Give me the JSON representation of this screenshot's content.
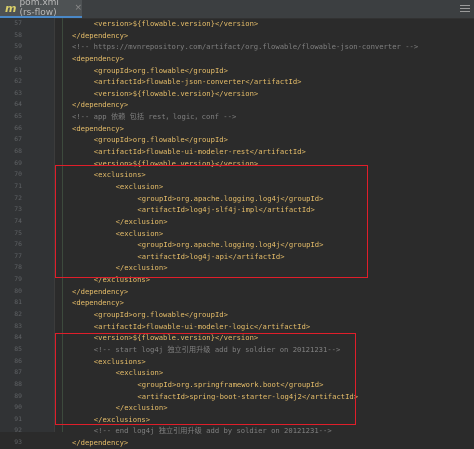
{
  "tab": {
    "title": "pom.xml (rs-flow)",
    "close": "×"
  },
  "lines": [
    {
      "n": "57",
      "i": 4,
      "t": "tag",
      "s": "<version>${flowable.version}</version>"
    },
    {
      "n": "58",
      "i": 2,
      "t": "tag",
      "s": "</dependency>"
    },
    {
      "n": "59",
      "i": 2,
      "t": "cmt",
      "s": "<!-- https://mvnrepository.com/artifact/org.flowable/flowable-json-converter -->"
    },
    {
      "n": "60",
      "i": 2,
      "t": "tag",
      "s": "<dependency>"
    },
    {
      "n": "61",
      "i": 4,
      "t": "tag",
      "s": "<groupId>org.flowable</groupId>"
    },
    {
      "n": "62",
      "i": 4,
      "t": "tag",
      "s": "<artifactId>flowable-json-converter</artifactId>"
    },
    {
      "n": "63",
      "i": 4,
      "t": "tag",
      "s": "<version>${flowable.version}</version>"
    },
    {
      "n": "64",
      "i": 2,
      "t": "tag",
      "s": "</dependency>"
    },
    {
      "n": "65",
      "i": 2,
      "t": "cmt",
      "s": "<!-- app 依赖 包括 rest，logic，conf -->"
    },
    {
      "n": "66",
      "i": 2,
      "t": "tag",
      "s": "<dependency>"
    },
    {
      "n": "67",
      "i": 4,
      "t": "tag",
      "s": "<groupId>org.flowable</groupId>"
    },
    {
      "n": "68",
      "i": 4,
      "t": "tag",
      "s": "<artifactId>flowable-ui-modeler-rest</artifactId>"
    },
    {
      "n": "69",
      "i": 4,
      "t": "tag",
      "s": "<version>${flowable.version}</version>"
    },
    {
      "n": "70",
      "i": 4,
      "t": "tag",
      "s": "<exclusions>"
    },
    {
      "n": "71",
      "i": 6,
      "t": "tag",
      "s": "<exclusion>"
    },
    {
      "n": "72",
      "i": 8,
      "t": "tag",
      "s": "<groupId>org.apache.logging.log4j</groupId>"
    },
    {
      "n": "73",
      "i": 8,
      "t": "tag",
      "s": "<artifactId>log4j-slf4j-impl</artifactId>"
    },
    {
      "n": "74",
      "i": 6,
      "t": "tag",
      "s": "</exclusion>"
    },
    {
      "n": "75",
      "i": 6,
      "t": "tag",
      "s": "<exclusion>"
    },
    {
      "n": "76",
      "i": 8,
      "t": "tag",
      "s": "<groupId>org.apache.logging.log4j</groupId>"
    },
    {
      "n": "77",
      "i": 8,
      "t": "tag",
      "s": "<artifactId>log4j-api</artifactId>"
    },
    {
      "n": "78",
      "i": 6,
      "t": "tag",
      "s": "</exclusion>"
    },
    {
      "n": "79",
      "i": 4,
      "t": "tag",
      "s": "</exclusions>"
    },
    {
      "n": "80",
      "i": 2,
      "t": "tag",
      "s": "</dependency>"
    },
    {
      "n": "81",
      "i": 2,
      "t": "tag",
      "s": "<dependency>"
    },
    {
      "n": "82",
      "i": 4,
      "t": "tag",
      "s": "<groupId>org.flowable</groupId>"
    },
    {
      "n": "83",
      "i": 4,
      "t": "tag",
      "s": "<artifactId>flowable-ui-modeler-logic</artifactId>"
    },
    {
      "n": "84",
      "i": 4,
      "t": "tag",
      "s": "<version>${flowable.version}</version>"
    },
    {
      "n": "85",
      "i": 4,
      "t": "cmt",
      "s": "<!-- start log4j 独立引用升级 add by soldier on 20121231-->"
    },
    {
      "n": "86",
      "i": 4,
      "t": "tag",
      "s": "<exclusions>"
    },
    {
      "n": "87",
      "i": 6,
      "t": "tag",
      "s": "<exclusion>"
    },
    {
      "n": "88",
      "i": 8,
      "t": "tag",
      "s": "<groupId>org.springframework.boot</groupId>"
    },
    {
      "n": "89",
      "i": 8,
      "t": "tag",
      "s": "<artifactId>spring-boot-starter-log4j2</artifactId>"
    },
    {
      "n": "90",
      "i": 6,
      "t": "tag",
      "s": "</exclusion>"
    },
    {
      "n": "91",
      "i": 4,
      "t": "tag",
      "s": "</exclusions>"
    },
    {
      "n": "92",
      "i": 4,
      "t": "cmt",
      "s": "<!-- end log4j 独立引用升级 add by soldier on 20121231-->"
    },
    {
      "n": "93",
      "i": 2,
      "t": "tag",
      "s": "</dependency>"
    }
  ],
  "colors": {
    "tag": "#e8bf6a",
    "comment": "#808080",
    "highlight": "#e01e2a",
    "background": "#2b2b2b"
  }
}
